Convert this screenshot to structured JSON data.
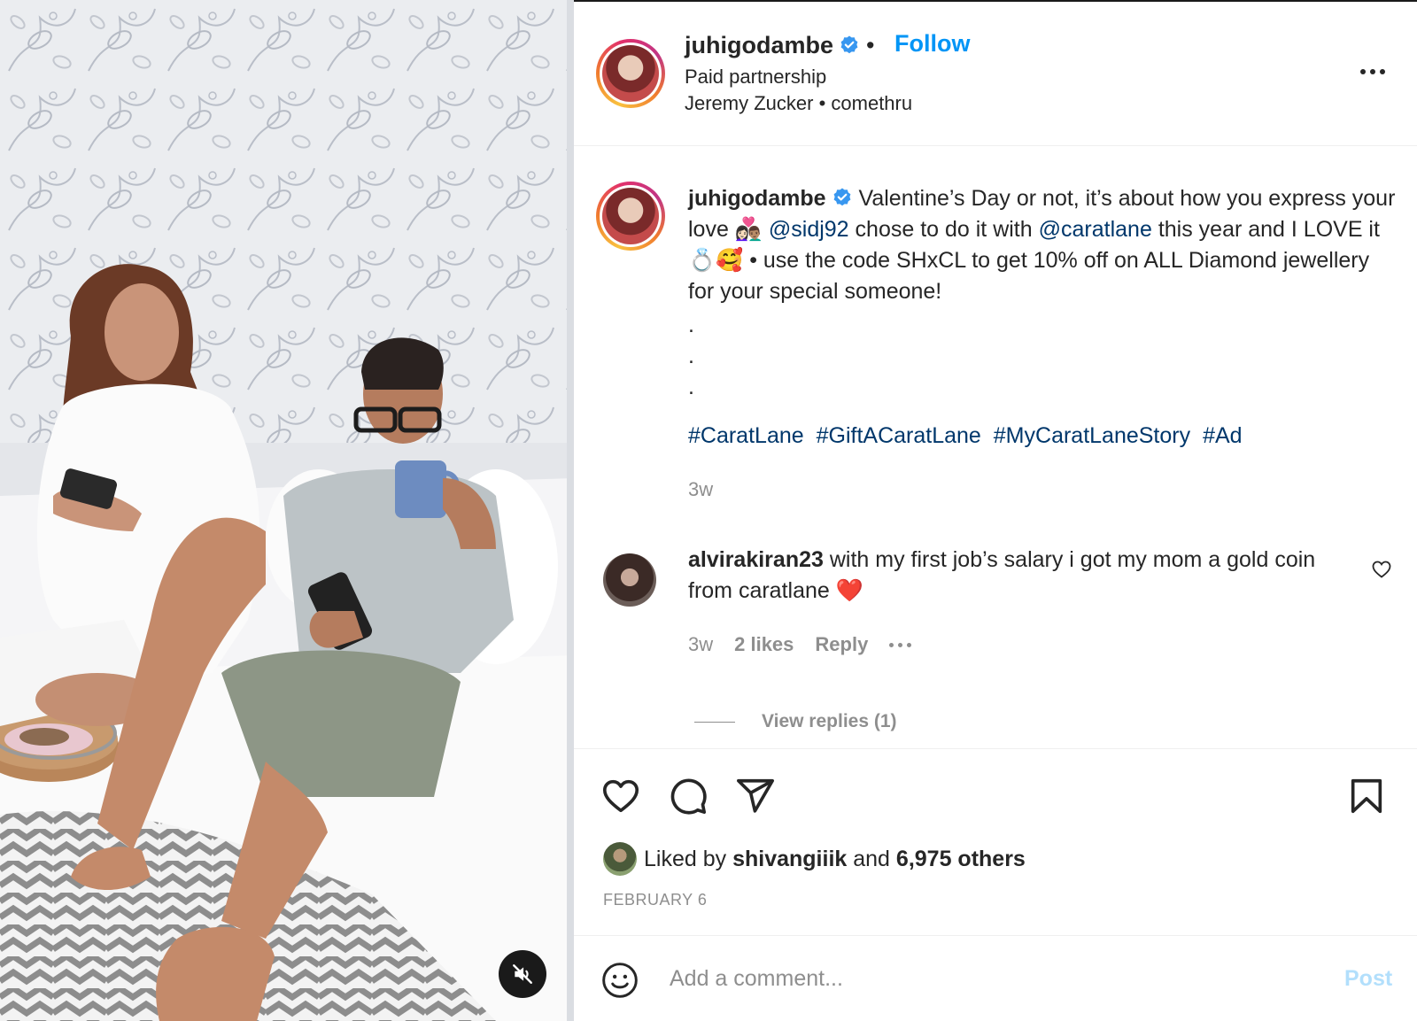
{
  "header": {
    "username": "juhigodambe",
    "separator": "•",
    "follow_label": "Follow",
    "subtitle": "Paid partnership",
    "music": "Jeremy Zucker • comethru"
  },
  "caption": {
    "username": "juhigodambe",
    "text_1": "Valentine’s Day or not, it’s about how you express your love 👩🏻‍❤️‍👨🏽",
    "mention_1": "@sidj92",
    "text_2": "chose to do it with",
    "mention_2": "@caratlane",
    "text_3": "this year and I LOVE it 💍🥰 • use the code SHxCL to get 10% off on ALL Diamond jewellery for your special someone!",
    "dots": [
      ".",
      ".",
      "."
    ],
    "hashtags": [
      "#CaratLane",
      "#GiftACaratLane",
      "#MyCaratLaneStory",
      "#Ad"
    ],
    "time": "3w"
  },
  "comment": {
    "username": "alvirakiran23",
    "text": "with my first job’s salary i got my mom a gold coin from caratlane ❤️",
    "time": "3w",
    "likes": "2 likes",
    "reply_label": "Reply",
    "view_replies": "View replies (1)"
  },
  "likes": {
    "prefix": "Liked by",
    "user": "shivangiiik",
    "and": "and",
    "others": "6,975 others"
  },
  "date": "FEBRUARY 6",
  "add_comment": {
    "placeholder": "Add a comment...",
    "post_label": "Post"
  },
  "icons": [
    "mute-icon",
    "more-icon",
    "verified-icon",
    "heart-icon",
    "comment-icon",
    "share-icon",
    "bookmark-icon",
    "emoji-icon"
  ],
  "colors": {
    "link_blue": "#0095f6",
    "mention_blue": "#00376b",
    "secondary_gray": "#8e8e8e",
    "post_disabled": "#b2dffc"
  }
}
